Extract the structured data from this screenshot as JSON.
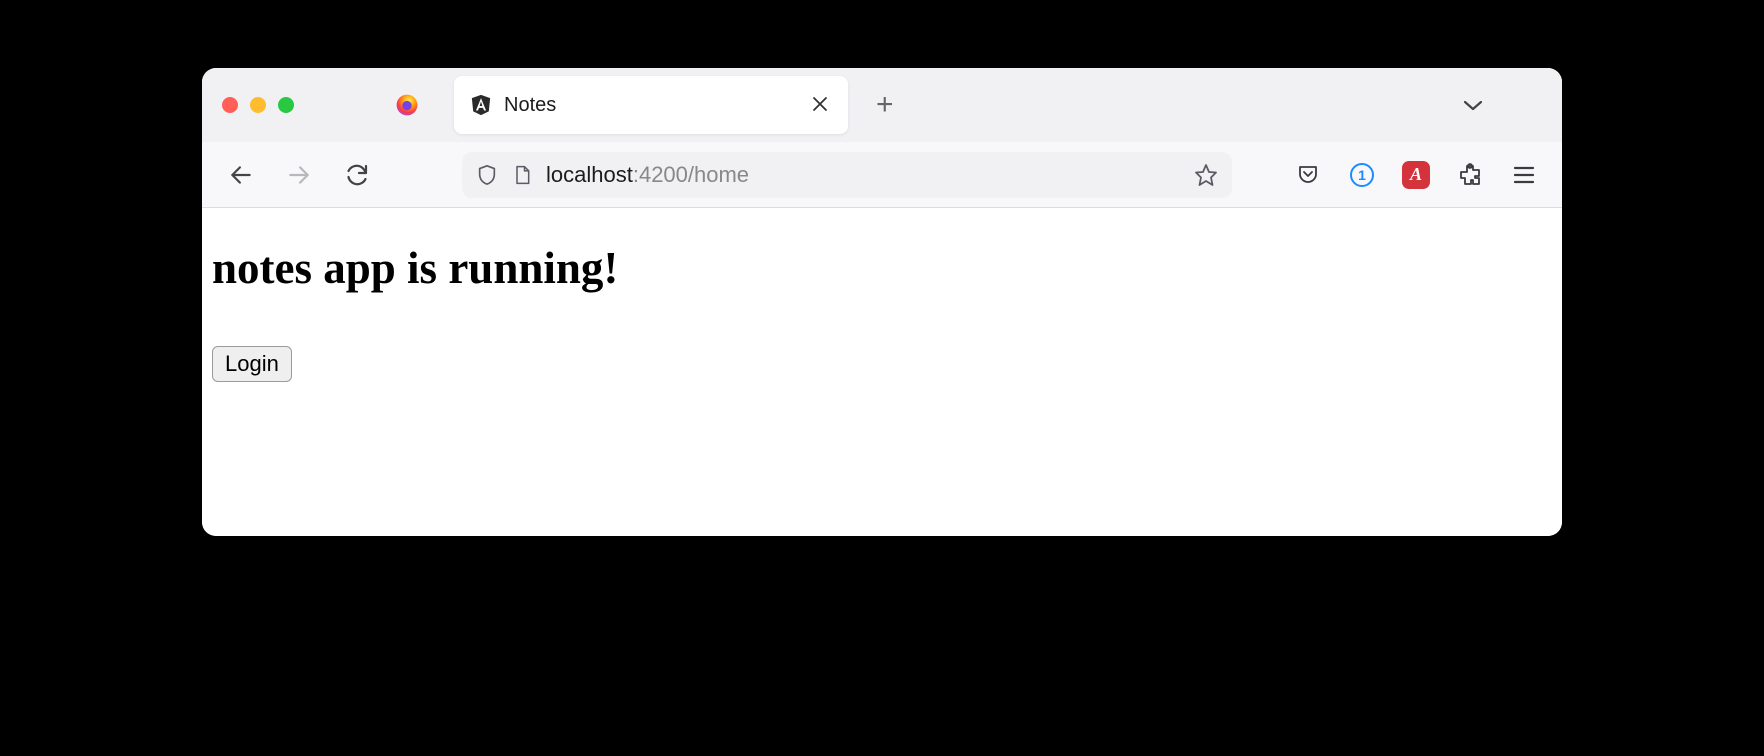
{
  "tab": {
    "title": "Notes"
  },
  "url": {
    "host": "localhost",
    "port_path": ":4200/home"
  },
  "page": {
    "heading": "notes app is running!",
    "login_label": "Login"
  }
}
